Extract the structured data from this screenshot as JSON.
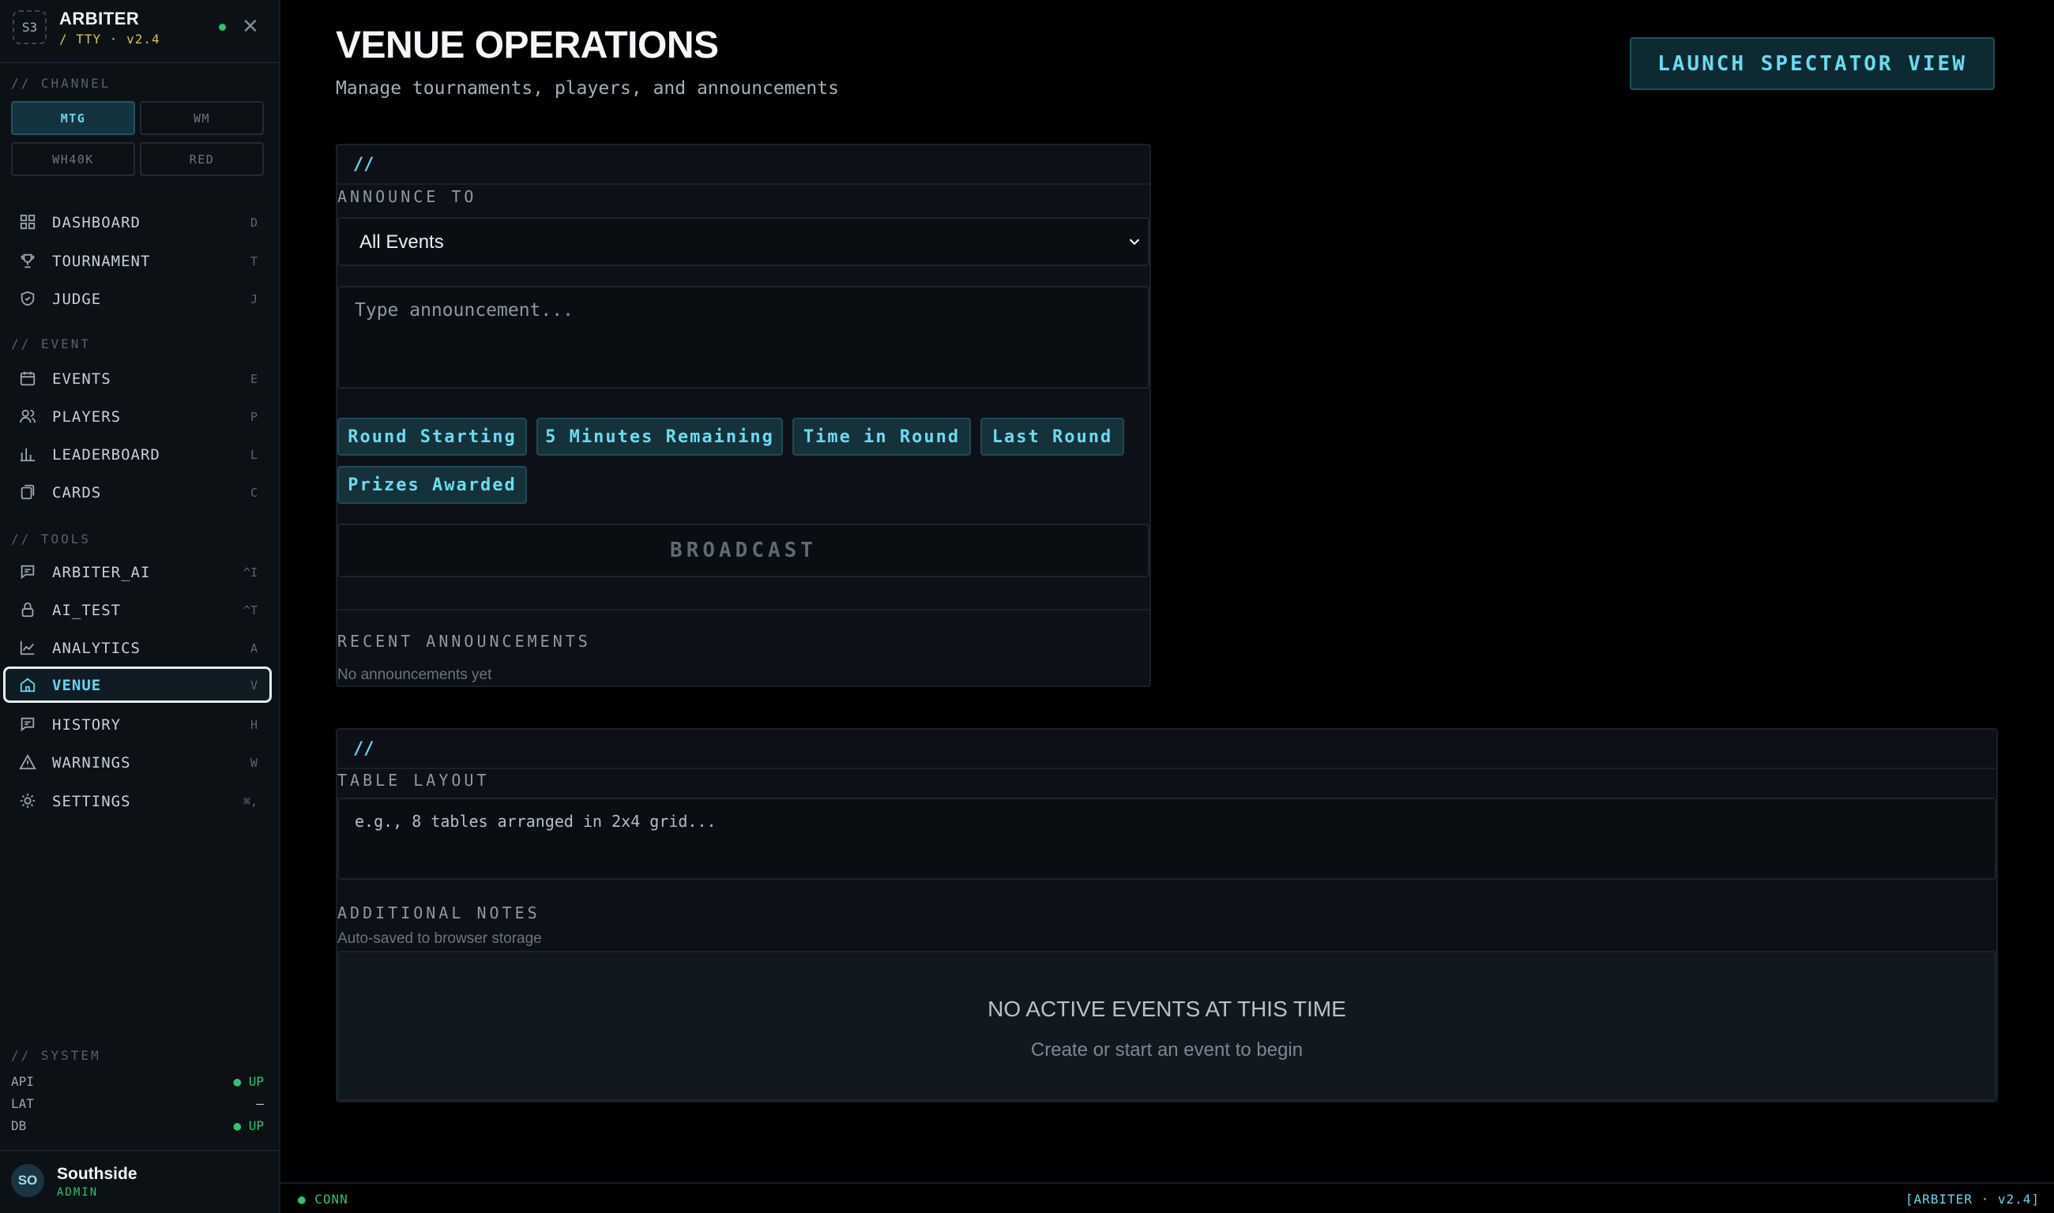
{
  "brand": {
    "logo": "S3",
    "name": "ARBITER",
    "sub": "/ TTY · v2.4"
  },
  "channel": {
    "label": "// CHANNEL",
    "options": [
      "MTG",
      "WM",
      "WH40K",
      "RED"
    ],
    "active": "MTG"
  },
  "nav": {
    "main": [
      {
        "label": "DASHBOARD",
        "key": "D",
        "icon": "dashboard-icon"
      },
      {
        "label": "TOURNAMENT",
        "key": "T",
        "icon": "trophy-icon"
      },
      {
        "label": "JUDGE",
        "key": "J",
        "icon": "shield-icon"
      }
    ],
    "event_label": "// EVENT",
    "event": [
      {
        "label": "EVENTS",
        "key": "E",
        "icon": "calendar-icon"
      },
      {
        "label": "PLAYERS",
        "key": "P",
        "icon": "users-icon"
      },
      {
        "label": "LEADERBOARD",
        "key": "L",
        "icon": "bar-chart-icon"
      },
      {
        "label": "CARDS",
        "key": "C",
        "icon": "cards-icon"
      }
    ],
    "tools_label": "// TOOLS",
    "tools": [
      {
        "label": "ARBITER_AI",
        "key": "^I",
        "icon": "chat-icon"
      },
      {
        "label": "AI_TEST",
        "key": "^T",
        "icon": "lock-icon"
      },
      {
        "label": "ANALYTICS",
        "key": "A",
        "icon": "line-chart-icon"
      },
      {
        "label": "VENUE",
        "key": "V",
        "icon": "home-icon",
        "active": true
      },
      {
        "label": "HISTORY",
        "key": "H",
        "icon": "chat-icon"
      },
      {
        "label": "WARNINGS",
        "key": "W",
        "icon": "warning-icon"
      },
      {
        "label": "SETTINGS",
        "key": "⌘,",
        "icon": "gear-icon"
      }
    ]
  },
  "system": {
    "label": "// SYSTEM",
    "rows": [
      {
        "name": "API",
        "value": "● UP"
      },
      {
        "name": "LAT",
        "value": "—"
      },
      {
        "name": "DB",
        "value": "● UP"
      }
    ]
  },
  "user": {
    "initials": "SO",
    "name": "Southside",
    "role": "ADMIN"
  },
  "header": {
    "title": "VENUE OPERATIONS",
    "subtitle": "Manage tournaments, players, and announcements",
    "launch_label": "LAUNCH SPECTATOR VIEW"
  },
  "announce": {
    "slash": "//",
    "label": "ANNOUNCE TO",
    "target": "All Events",
    "placeholder": "Type announcement...",
    "quick": [
      "Round Starting",
      "5 Minutes Remaining",
      "Time in Round",
      "Last Round",
      "Prizes Awarded"
    ],
    "broadcast_label": "BROADCAST",
    "recent_label": "RECENT ANNOUNCEMENTS",
    "recent_empty": "No announcements yet"
  },
  "layout": {
    "slash": "//",
    "table_label": "TABLE LAYOUT",
    "table_placeholder": "e.g., 8 tables arranged in 2x4 grid...",
    "notes_label": "ADDITIONAL NOTES",
    "notes_hint": "Auto-saved to browser storage",
    "empty_title": "NO ACTIVE EVENTS AT THIS TIME",
    "empty_sub": "Create or start an event to begin"
  },
  "footer": {
    "left": "● CONN",
    "right": "[ARBITER · v2.4]"
  },
  "colors": {
    "accent": "#66d5ee",
    "ok": "#2fc46b",
    "bg": "#000000",
    "panel": "#0d1117"
  }
}
